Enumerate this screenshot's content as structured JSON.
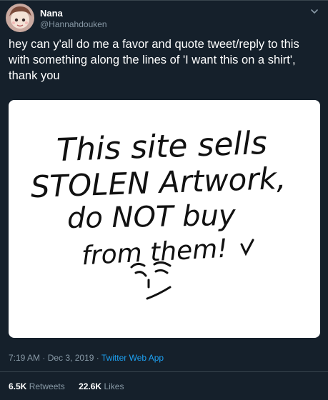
{
  "author": {
    "display_name": "Nana",
    "handle": "@Hannahdouken"
  },
  "tweet": {
    "text": "hey can y'all do me a favor and quote tweet/reply to this with something along the lines of 'I want this on a shirt', thank you"
  },
  "image": {
    "line1": "This site sells",
    "line2": "STOLEN Artwork,",
    "line3": "do NOT buy",
    "line4": "from them!"
  },
  "meta": {
    "time": "7:19 AM",
    "date": "Dec 3, 2019",
    "source": "Twitter Web App",
    "separator": "·"
  },
  "stats": {
    "retweets_count": "6.5K",
    "retweets_label": "Retweets",
    "likes_count": "22.6K",
    "likes_label": "Likes"
  },
  "colors": {
    "background": "#15202b",
    "secondary_text": "#8899a6",
    "link": "#1da1f2",
    "border": "#38444d"
  },
  "icons": [
    "chevron-down-icon"
  ]
}
